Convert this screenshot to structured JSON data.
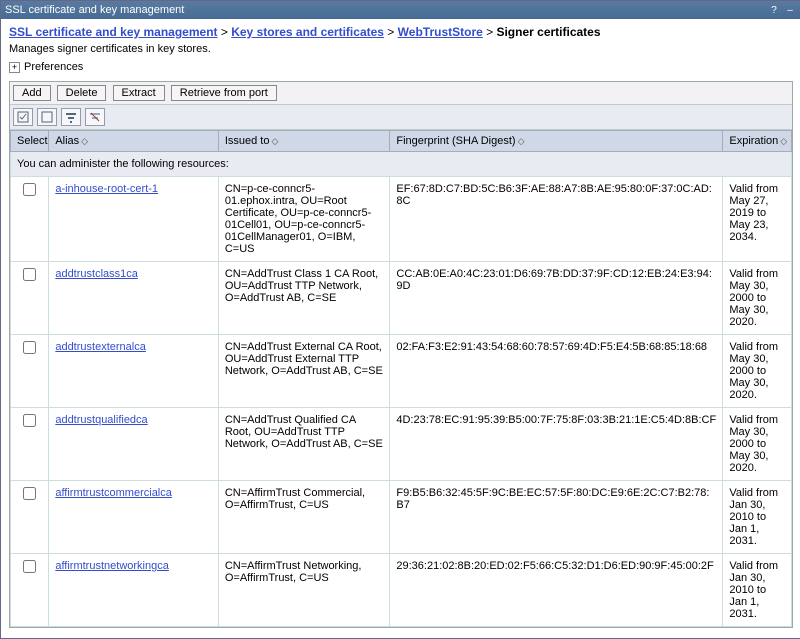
{
  "titlebar": {
    "title": "SSL certificate and key management"
  },
  "breadcrumb": {
    "a": "SSL certificate and key management",
    "b": "Key stores and certificates",
    "c": "WebTrustStore",
    "current": "Signer certificates",
    "sep": " > "
  },
  "description": "Manages signer certificates in key stores.",
  "preferences_label": "Preferences",
  "buttons": {
    "add": "Add",
    "delete": "Delete",
    "extract": "Extract",
    "retrieve": "Retrieve from port"
  },
  "columns": {
    "select": "Select",
    "alias": "Alias",
    "issued": "Issued to",
    "fingerprint": "Fingerprint (SHA Digest)",
    "expiration": "Expiration"
  },
  "admin_msg": "You can administer the following resources:",
  "rows": [
    {
      "alias": "a-inhouse-root-cert-1",
      "issued": "CN=p-ce-conncr5-01.ephox.intra, OU=Root Certificate, OU=p-ce-conncr5-01Cell01, OU=p-ce-conncr5-01CellManager01, O=IBM, C=US",
      "fp": "EF:67:8D:C7:BD:5C:B6:3F:AE:88:A7:8B:AE:95:80:0F:37:0C:AD:8C",
      "exp": "Valid from May 27, 2019 to May 23, 2034."
    },
    {
      "alias": "addtrustclass1ca",
      "issued": "CN=AddTrust Class 1 CA Root, OU=AddTrust TTP Network, O=AddTrust AB, C=SE",
      "fp": "CC:AB:0E:A0:4C:23:01:D6:69:7B:DD:37:9F:CD:12:EB:24:E3:94:9D",
      "exp": "Valid from May 30, 2000 to May 30, 2020."
    },
    {
      "alias": "addtrustexternalca",
      "issued": "CN=AddTrust External CA Root, OU=AddTrust External TTP Network, O=AddTrust AB, C=SE",
      "fp": "02:FA:F3:E2:91:43:54:68:60:78:57:69:4D:F5:E4:5B:68:85:18:68",
      "exp": "Valid from May 30, 2000 to May 30, 2020."
    },
    {
      "alias": "addtrustqualifiedca",
      "issued": "CN=AddTrust Qualified CA Root, OU=AddTrust TTP Network, O=AddTrust AB, C=SE",
      "fp": "4D:23:78:EC:91:95:39:B5:00:7F:75:8F:03:3B:21:1E:C5:4D:8B:CF",
      "exp": "Valid from May 30, 2000 to May 30, 2020."
    },
    {
      "alias": "affirmtrustcommercialca",
      "issued": "CN=AffirmTrust Commercial, O=AffirmTrust, C=US",
      "fp": "F9:B5:B6:32:45:5F:9C:BE:EC:57:5F:80:DC:E9:6E:2C:C7:B2:78:B7",
      "exp": "Valid from Jan 30, 2010 to Jan 1, 2031."
    },
    {
      "alias": "affirmtrustnetworkingca",
      "issued": "CN=AffirmTrust Networking, O=AffirmTrust, C=US",
      "fp": "29:36:21:02:8B:20:ED:02:F5:66:C5:32:D1:D6:ED:90:9F:45:00:2F",
      "exp": "Valid from Jan 30, 2010 to Jan 1, 2031."
    }
  ]
}
